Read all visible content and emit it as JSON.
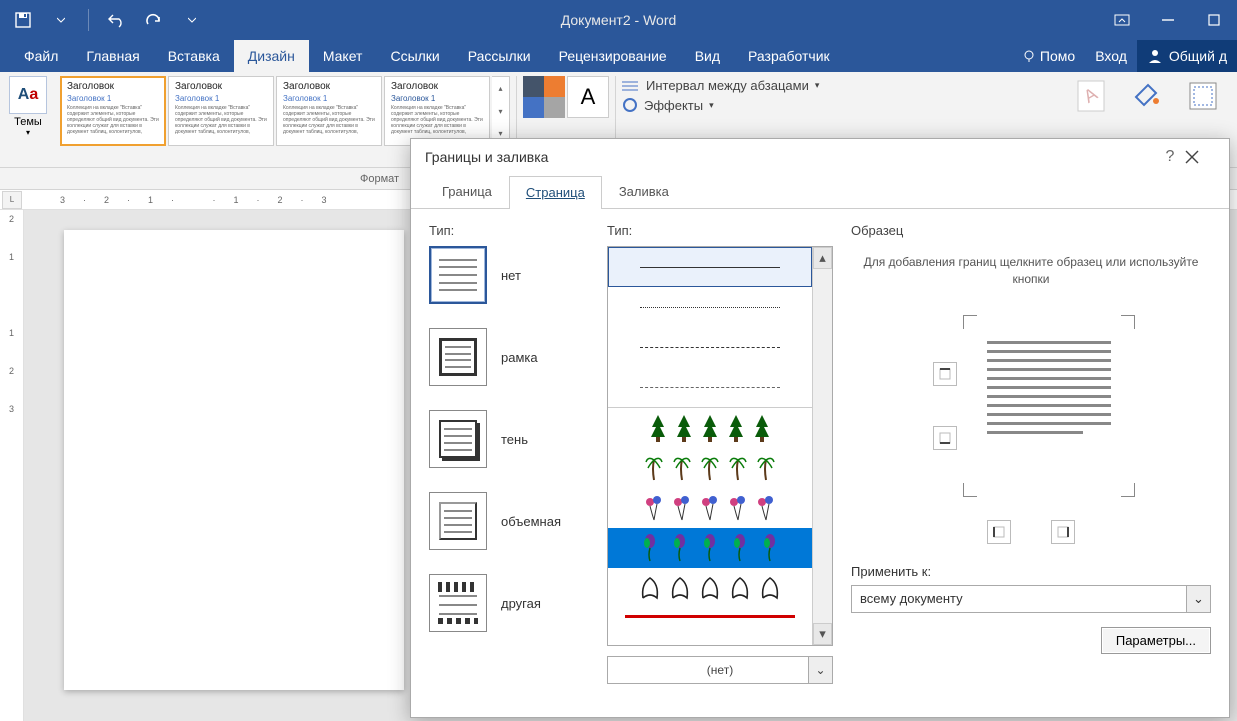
{
  "titlebar": {
    "title": "Документ2 - Word"
  },
  "ribbon_tabs": {
    "file": "Файл",
    "home": "Главная",
    "insert": "Вставка",
    "design": "Дизайн",
    "layout": "Макет",
    "references": "Ссылки",
    "mailings": "Рассылки",
    "review": "Рецензирование",
    "view": "Вид",
    "developer": "Разработчик",
    "tellme": "Помо",
    "signin": "Вход",
    "share": "Общий д"
  },
  "ribbon": {
    "themes": "Темы",
    "gallery_heading": "Заголовок",
    "gallery_sub": "Заголовок 1",
    "gallery_body": "Коллекция на вкладке \"Вставка\" содержит элементы, которые определяют общий вид документа. Эти коллекции служат для вставки в документ таблиц, колонтитулов,",
    "para_spacing": "Интервал между абзацами",
    "effects": "Эффекты",
    "watermark": "Подложка",
    "pagecolor": "Цвет страницы",
    "borders": "Границы страниц",
    "format_group": "Формат"
  },
  "ruler_h": [
    "3",
    "2",
    "1",
    "",
    "1",
    "2",
    "3"
  ],
  "ruler_v": [
    "2",
    "1",
    "",
    "1",
    "2",
    "3"
  ],
  "dialog": {
    "title": "Границы и заливка",
    "tabs": {
      "border": "Граница",
      "page": "Страница",
      "shading": "Заливка"
    },
    "type_label": "Тип:",
    "settings": {
      "none": "нет",
      "box": "рамка",
      "shadow": "тень",
      "threeD": "объемная",
      "custom": "другая"
    },
    "style_label": "Тип:",
    "art_value": "(нет)",
    "preview_label": "Образец",
    "preview_hint": "Для добавления границ щелкните образец или используйте кнопки",
    "apply_label": "Применить к:",
    "apply_value": "всему документу",
    "options_btn": "Параметры..."
  }
}
